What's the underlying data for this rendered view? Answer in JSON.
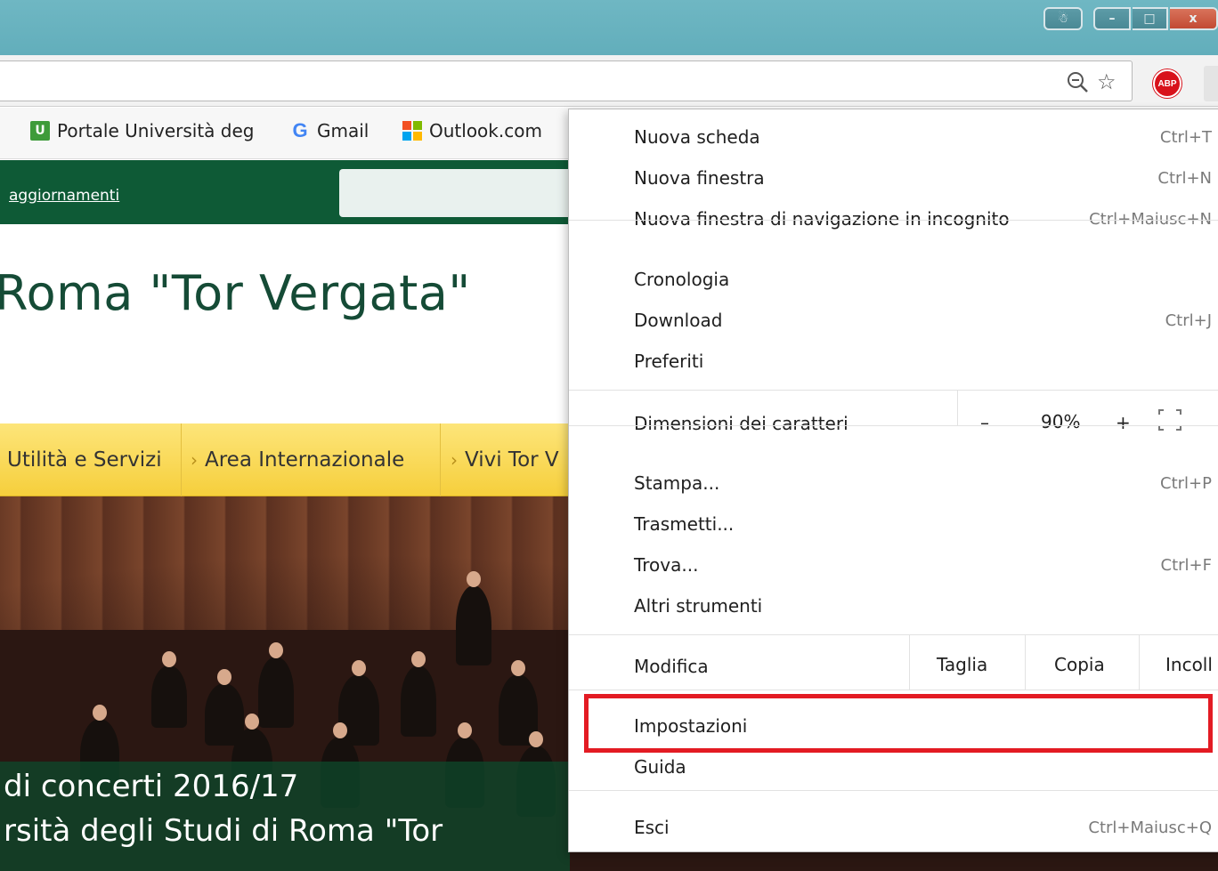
{
  "browser": {
    "window_buttons": {
      "user": "☃",
      "minimize": "–",
      "maximize": "□",
      "close": "x"
    },
    "toolbar": {
      "zoom_icon": "magnifier-minus-icon",
      "star_icon": "star-icon",
      "adblock_label": "ABP"
    },
    "bookmarks": [
      {
        "label": "Portale Università deg",
        "icon": "university-icon"
      },
      {
        "label": "Gmail",
        "icon": "google-icon"
      },
      {
        "label": "Outlook.com",
        "icon": "microsoft-icon"
      }
    ]
  },
  "page": {
    "top_link": "aggiornamenti",
    "site_title": "Roma \"Tor Vergata\"",
    "nav": [
      "Utilità e Servizi",
      "Area Internazionale",
      "Vivi Tor V"
    ],
    "hero_caption": [
      "di concerti 2016/17",
      "rsità degli Studi di Roma \"Tor"
    ]
  },
  "menu": {
    "items": {
      "new_tab": {
        "label": "Nuova scheda",
        "shortcut": "Ctrl+T"
      },
      "new_window": {
        "label": "Nuova finestra",
        "shortcut": "Ctrl+N"
      },
      "incognito": {
        "label": "Nuova finestra di navigazione in incognito",
        "shortcut": "Ctrl+Maiusc+N"
      },
      "history": {
        "label": "Cronologia",
        "shortcut": ""
      },
      "downloads": {
        "label": "Download",
        "shortcut": "Ctrl+J"
      },
      "bookmarks": {
        "label": "Preferiti",
        "shortcut": ""
      },
      "zoom": {
        "label": "Dimensioni dei caratteri",
        "minus": "–",
        "value": "90%",
        "plus": "+"
      },
      "print": {
        "label": "Stampa...",
        "shortcut": "Ctrl+P"
      },
      "cast": {
        "label": "Trasmetti...",
        "shortcut": ""
      },
      "find": {
        "label": "Trova...",
        "shortcut": "Ctrl+F"
      },
      "more_tools": {
        "label": "Altri strumenti",
        "shortcut": ""
      },
      "edit": {
        "label": "Modifica",
        "cut": "Taglia",
        "copy": "Copia",
        "paste": "Incoll"
      },
      "settings": {
        "label": "Impostazioni",
        "shortcut": ""
      },
      "help": {
        "label": "Guida",
        "shortcut": ""
      },
      "exit": {
        "label": "Esci",
        "shortcut": "Ctrl+Maiusc+Q"
      }
    },
    "highlight_color": "#e31b23"
  }
}
